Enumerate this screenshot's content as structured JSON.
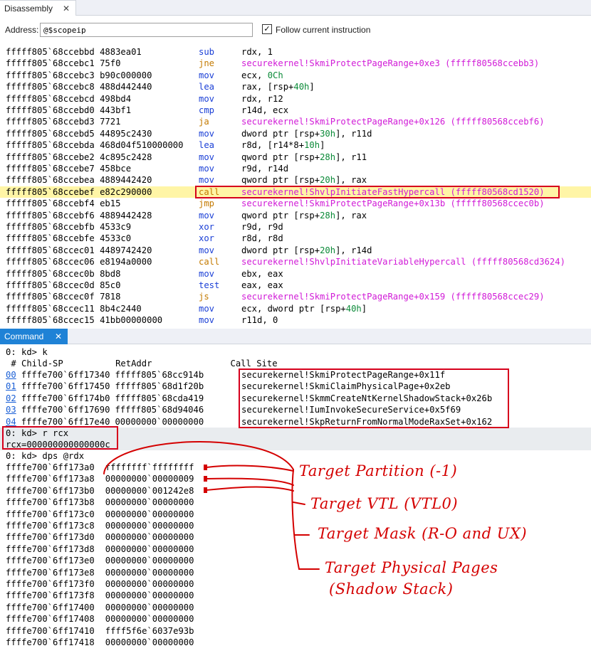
{
  "disassembly": {
    "tab_label": "Disassembly",
    "close_glyph": "✕",
    "address_label": "Address:",
    "address_value": "@$scopeip",
    "follow_checked": "✓",
    "follow_label": "Follow current instruction",
    "lines": [
      {
        "addr": "fffff805`68ccebbd 4883ea01",
        "op": "sub",
        "args": [
          [
            "rdx, 1",
            "t"
          ]
        ]
      },
      {
        "addr": "fffff805`68ccebc1 75f0",
        "op": "jne",
        "args": [
          [
            "securekernel!SkmiProtectPageRange+0xe3 (fffff80568ccebb3)",
            "s"
          ]
        ]
      },
      {
        "addr": "fffff805`68ccebc3 b90c000000",
        "op": "mov",
        "args": [
          [
            "ecx, ",
            "t"
          ],
          [
            "0Ch",
            "n"
          ]
        ]
      },
      {
        "addr": "fffff805`68ccebc8 488d442440",
        "op": "lea",
        "args": [
          [
            "rax, [rsp+",
            "t"
          ],
          [
            "40h",
            "n"
          ],
          [
            "]",
            "t"
          ]
        ]
      },
      {
        "addr": "fffff805`68ccebcd 498bd4",
        "op": "mov",
        "args": [
          [
            "rdx, r12",
            "t"
          ]
        ]
      },
      {
        "addr": "fffff805`68ccebd0 443bf1",
        "op": "cmp",
        "args": [
          [
            "r14d, ecx",
            "t"
          ]
        ]
      },
      {
        "addr": "fffff805`68ccebd3 7721",
        "op": "ja",
        "args": [
          [
            "securekernel!SkmiProtectPageRange+0x126 (fffff80568ccebf6)",
            "s"
          ]
        ]
      },
      {
        "addr": "fffff805`68ccebd5 44895c2430",
        "op": "mov",
        "args": [
          [
            "dword ptr [rsp+",
            "t"
          ],
          [
            "30h",
            "n"
          ],
          [
            "], r11d",
            "t"
          ]
        ]
      },
      {
        "addr": "fffff805`68ccebda 468d04f510000000",
        "op": "lea",
        "args": [
          [
            "r8d, [r14*8+",
            "t"
          ],
          [
            "10h",
            "n"
          ],
          [
            "]",
            "t"
          ]
        ]
      },
      {
        "addr": "fffff805`68ccebe2 4c895c2428",
        "op": "mov",
        "args": [
          [
            "qword ptr [rsp+",
            "t"
          ],
          [
            "28h",
            "n"
          ],
          [
            "], r11",
            "t"
          ]
        ]
      },
      {
        "addr": "fffff805`68ccebe7 458bce",
        "op": "mov",
        "args": [
          [
            "r9d, r14d",
            "t"
          ]
        ]
      },
      {
        "addr": "fffff805`68ccebea 4889442420",
        "op": "mov",
        "args": [
          [
            "qword ptr [rsp+",
            "t"
          ],
          [
            "20h",
            "n"
          ],
          [
            "], rax",
            "t"
          ]
        ]
      },
      {
        "addr": "fffff805`68ccebef e82c290000",
        "op": "call",
        "args": [
          [
            "securekernel!ShvlpInitiateFastHypercall (fffff80568cd1520)",
            "s"
          ]
        ],
        "highlight": true
      },
      {
        "addr": "fffff805`68ccebf4 eb15",
        "op": "jmp",
        "args": [
          [
            "securekernel!SkmiProtectPageRange+0x13b (fffff80568ccec0b)",
            "s"
          ]
        ]
      },
      {
        "addr": "fffff805`68ccebf6 4889442428",
        "op": "mov",
        "args": [
          [
            "qword ptr [rsp+",
            "t"
          ],
          [
            "28h",
            "n"
          ],
          [
            "], rax",
            "t"
          ]
        ]
      },
      {
        "addr": "fffff805`68ccebfb 4533c9",
        "op": "xor",
        "args": [
          [
            "r9d, r9d",
            "t"
          ]
        ]
      },
      {
        "addr": "fffff805`68ccebfe 4533c0",
        "op": "xor",
        "args": [
          [
            "r8d, r8d",
            "t"
          ]
        ]
      },
      {
        "addr": "fffff805`68ccec01 4489742420",
        "op": "mov",
        "args": [
          [
            "dword ptr [rsp+",
            "t"
          ],
          [
            "20h",
            "n"
          ],
          [
            "], r14d",
            "t"
          ]
        ]
      },
      {
        "addr": "fffff805`68ccec06 e8194a0000",
        "op": "call",
        "args": [
          [
            "securekernel!ShvlpInitiateVariableHypercall (fffff80568cd3624)",
            "s"
          ]
        ]
      },
      {
        "addr": "fffff805`68ccec0b 8bd8",
        "op": "mov",
        "args": [
          [
            "ebx, eax",
            "t"
          ]
        ]
      },
      {
        "addr": "fffff805`68ccec0d 85c0",
        "op": "test",
        "args": [
          [
            "eax, eax",
            "t"
          ]
        ]
      },
      {
        "addr": "fffff805`68ccec0f 7818",
        "op": "js",
        "args": [
          [
            "securekernel!SkmiProtectPageRange+0x159 (fffff80568ccec29)",
            "s"
          ]
        ]
      },
      {
        "addr": "fffff805`68ccec11 8b4c2440",
        "op": "mov",
        "args": [
          [
            "ecx, dword ptr [rsp+",
            "t"
          ],
          [
            "40h",
            "n"
          ],
          [
            "]",
            "t"
          ]
        ]
      },
      {
        "addr": "fffff805`68ccec15 41bb00000000",
        "op": "mov",
        "args": [
          [
            "r11d, 0",
            "t"
          ]
        ]
      }
    ]
  },
  "command": {
    "tab_label": "Command",
    "close_glyph": "✕",
    "prompt_k": "0: kd> k",
    "stack_header": " # Child-SP          RetAddr               Call Site",
    "frames": [
      {
        "num": "00",
        "child_sp": "ffffe700`6ff17340",
        "ret": "fffff805`68cc914b",
        "site": "securekernel!SkmiProtectPageRange+0x11f"
      },
      {
        "num": "01",
        "child_sp": "ffffe700`6ff17450",
        "ret": "fffff805`68d1f20b",
        "site": "securekernel!SkmiClaimPhysicalPage+0x2eb"
      },
      {
        "num": "02",
        "child_sp": "ffffe700`6ff174b0",
        "ret": "fffff805`68cda419",
        "site": "securekernel!SkmmCreateNtKernelShadowStack+0x26b"
      },
      {
        "num": "03",
        "child_sp": "ffffe700`6ff17690",
        "ret": "fffff805`68d94046",
        "site": "securekernel!IumInvokeSecureService+0x5f69"
      },
      {
        "num": "04",
        "child_sp": "ffffe700`6ff17e40",
        "ret": "00000000`00000000",
        "site": "securekernel!SkpReturnFromNormalModeRaxSet+0x162"
      }
    ],
    "prompt_r": "0: kd> r rcx",
    "rcx_output": "rcx=000000000000000c",
    "prompt_dps": "0: kd> dps @rdx",
    "dps_rows": [
      {
        "addr": "ffffe700`6ff173a0",
        "val": "ffffffff`ffffffff"
      },
      {
        "addr": "ffffe700`6ff173a8",
        "val": "00000000`00000009"
      },
      {
        "addr": "ffffe700`6ff173b0",
        "val": "00000000`001242e8"
      },
      {
        "addr": "ffffe700`6ff173b8",
        "val": "00000000`00000000"
      },
      {
        "addr": "ffffe700`6ff173c0",
        "val": "00000000`00000000"
      },
      {
        "addr": "ffffe700`6ff173c8",
        "val": "00000000`00000000"
      },
      {
        "addr": "ffffe700`6ff173d0",
        "val": "00000000`00000000"
      },
      {
        "addr": "ffffe700`6ff173d8",
        "val": "00000000`00000000"
      },
      {
        "addr": "ffffe700`6ff173e0",
        "val": "00000000`00000000"
      },
      {
        "addr": "ffffe700`6ff173e8",
        "val": "00000000`00000000"
      },
      {
        "addr": "ffffe700`6ff173f0",
        "val": "00000000`00000000"
      },
      {
        "addr": "ffffe700`6ff173f8",
        "val": "00000000`00000000"
      },
      {
        "addr": "ffffe700`6ff17400",
        "val": "00000000`00000000"
      },
      {
        "addr": "ffffe700`6ff17408",
        "val": "00000000`00000000"
      },
      {
        "addr": "ffffe700`6ff17410",
        "val": "ffff5f6e`6037e93b"
      },
      {
        "addr": "ffffe700`6ff17418",
        "val": "00000000`00000000"
      }
    ]
  },
  "annotations": {
    "color": "#d40000",
    "partition": "Target Partition (-1)",
    "vtl": "Target VTL (VTL0)",
    "mask": "Target Mask (R-O and UX)",
    "pages_line1": "Target Physical Pages",
    "pages_line2": "(Shadow Stack)"
  },
  "colors": {
    "opcode_blue": "#1a3fd6",
    "opcode_jump": "#c47a00",
    "symbol_magenta": "#d11ad7",
    "number_green": "#0b8a38",
    "highlight_yellow": "#fff5a6",
    "command_tab_blue": "#1f82d6",
    "box_red": "#d6001c"
  }
}
